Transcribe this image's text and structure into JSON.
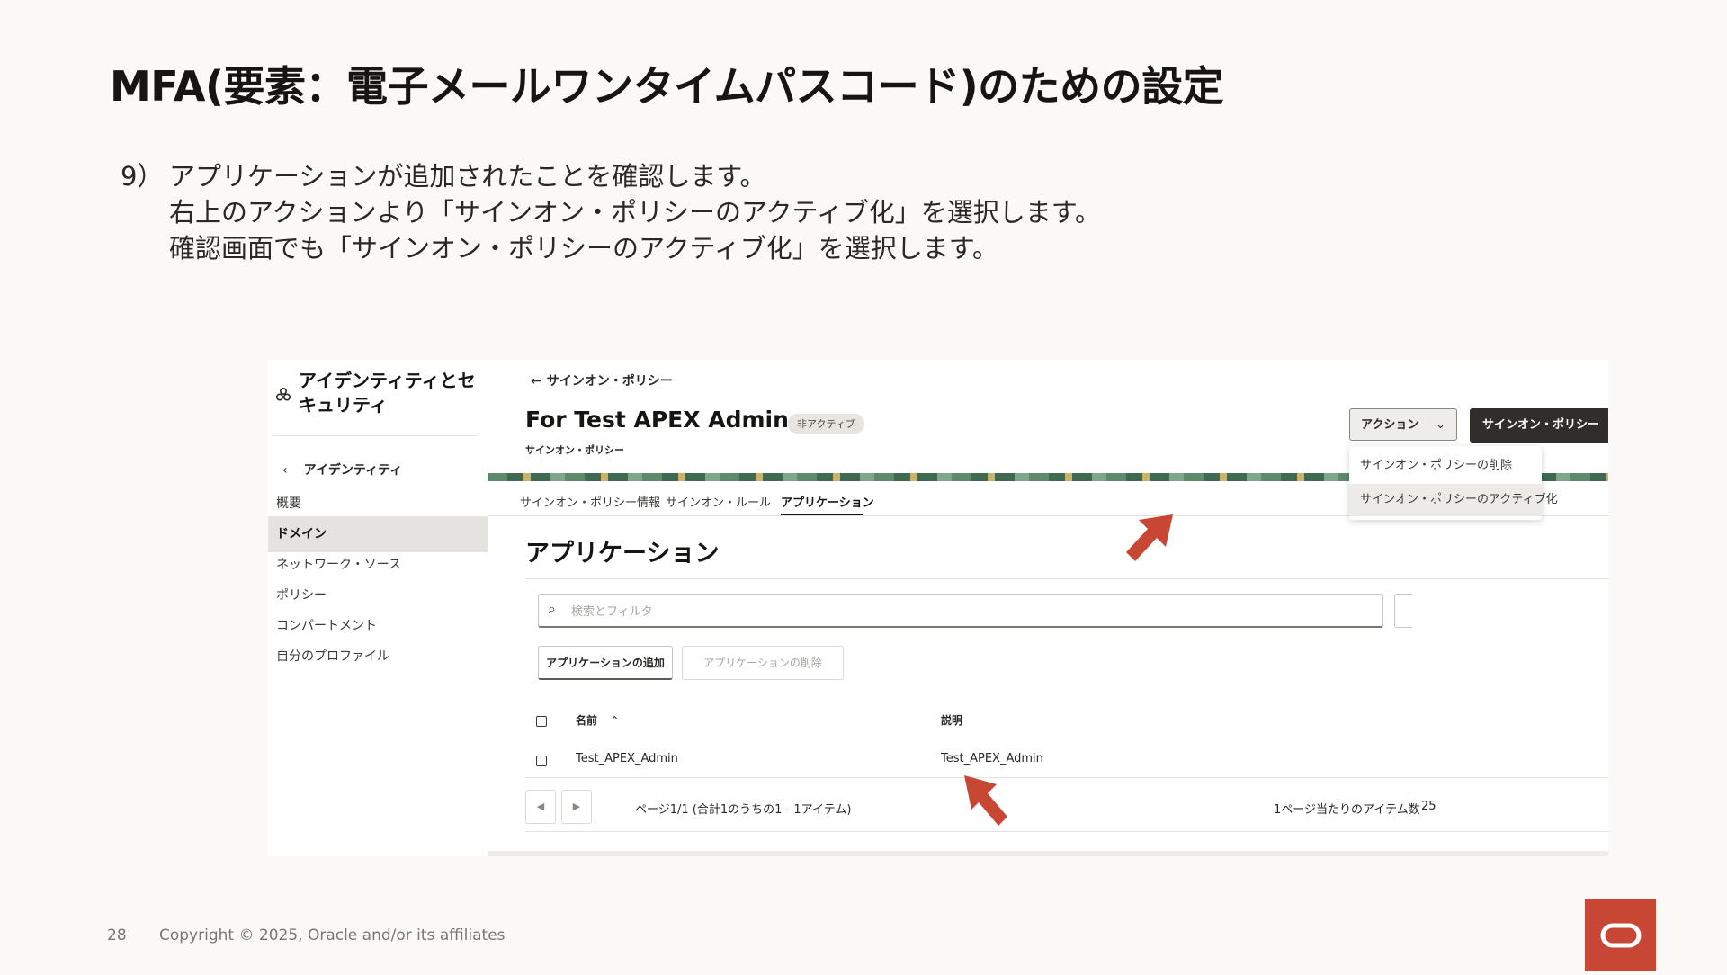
{
  "slide": {
    "title": "MFA(要素：電子メールワンタイムパスコード)のための設定",
    "step_number": "9）",
    "instructions": [
      "アプリケーションが追加されたことを確認します。",
      "右上のアクションより「サインオン・ポリシーのアクティブ化」を選択します。",
      "確認画面でも「サインオン・ポリシーのアクティブ化」を選択します。"
    ],
    "page_number": "28",
    "copyright": "Copyright © 2025, Oracle and/or its affiliates",
    "accent_color": "#c74634"
  },
  "console": {
    "sidebar": {
      "title": "アイデンティティとセキュリティ",
      "logo_icon": "identity-security-icon",
      "back_label": "アイデンティティ",
      "items": [
        {
          "label": "概要",
          "active": false
        },
        {
          "label": "ドメイン",
          "active": true
        },
        {
          "label": "ネットワーク・ソース",
          "active": false
        },
        {
          "label": "ポリシー",
          "active": false
        },
        {
          "label": "コンパートメント",
          "active": false
        },
        {
          "label": "自分のプロファイル",
          "active": false
        }
      ]
    },
    "header": {
      "breadcrumb": "サインオン・ポリシー",
      "title": "For Test APEX Admin",
      "status_badge": "非アクティブ",
      "subtitle": "サインオン・ポリシー",
      "actions_button": "アクション",
      "activate_button": "サインオン・ポリシー"
    },
    "actions_menu": {
      "items": [
        {
          "label": "サインオン・ポリシーの削除",
          "highlighted": false
        },
        {
          "label": "サインオン・ポリシーのアクティブ化",
          "highlighted": true
        }
      ]
    },
    "tabs": [
      {
        "label": "サインオン・ポリシー情報",
        "active": false
      },
      {
        "label": "サインオン・ルール",
        "active": false
      },
      {
        "label": "アプリケーション",
        "active": true
      }
    ],
    "section": {
      "title": "アプリケーション",
      "search_placeholder": "検索とフィルタ",
      "add_button": "アプリケーションの追加",
      "delete_button": "アプリケーションの削除"
    },
    "table": {
      "columns": [
        "名前",
        "説明"
      ],
      "sort_icon": "sort-ascending-icon",
      "rows": [
        {
          "name": "Test_APEX_Admin",
          "description": "Test_APEX_Admin"
        }
      ]
    },
    "pagination": {
      "info": "ページ1/1 (合計1のうちの1 - 1アイテム)",
      "page_size_label": "1ページ当たりのアイテム数",
      "page_size": "25"
    }
  }
}
